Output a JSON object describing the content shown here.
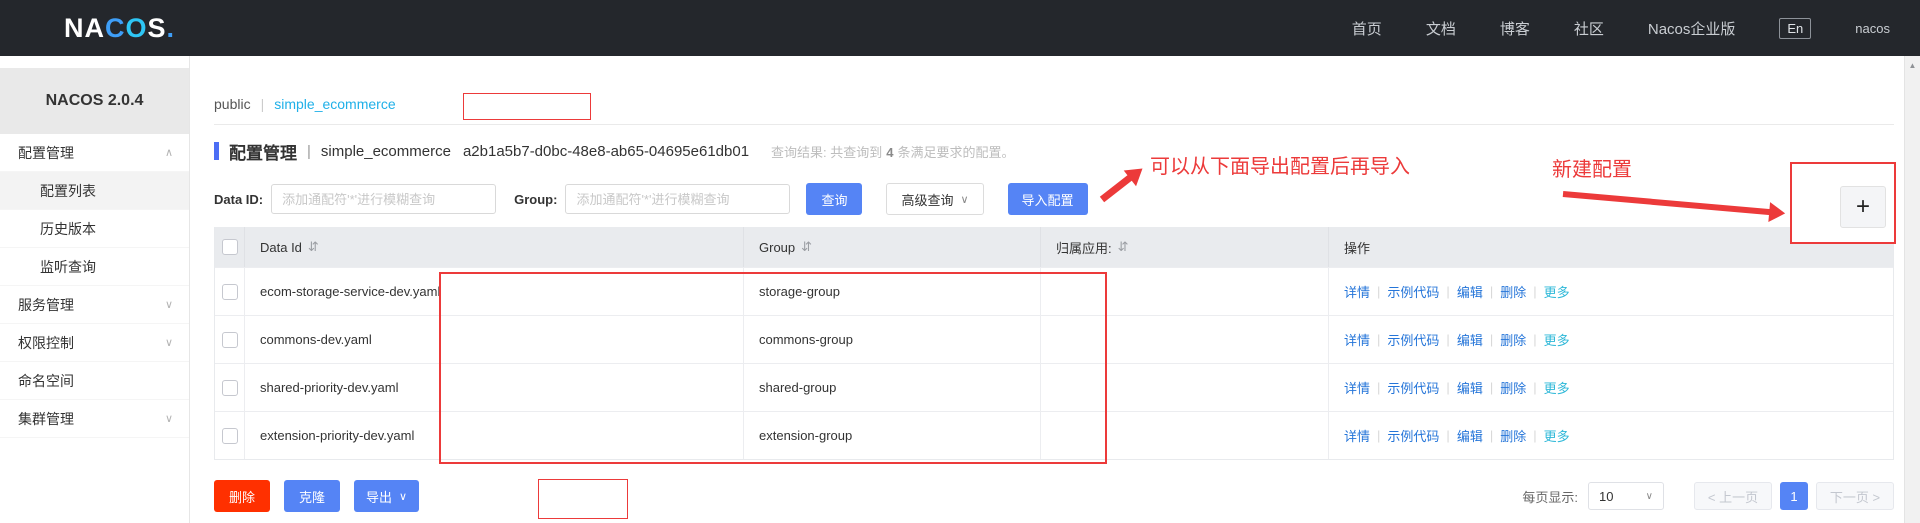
{
  "colors": {
    "primary_blue": "#5584f5",
    "danger_red": "#ff3000",
    "link_blue": "#2575d9",
    "more_cyan": "#2eb8d8",
    "tab_cyan": "#1fb0e8",
    "annotation_red": "#ec3a3a",
    "navbar_dark": "#24272c",
    "table_header_gray": "#e9ebee"
  },
  "navbar": {
    "logo_parts": [
      "NA",
      "C",
      "O",
      "S",
      "."
    ],
    "items": [
      "首页",
      "文档",
      "博客",
      "社区",
      "Nacos企业版"
    ],
    "lang": "En",
    "username": "nacos"
  },
  "sidebar": {
    "version": "NACOS 2.0.4",
    "items": [
      {
        "label": "配置管理"
      },
      {
        "label": "配置列表"
      },
      {
        "label": "历史版本"
      },
      {
        "label": "监听查询"
      },
      {
        "label": "服务管理"
      },
      {
        "label": "权限控制"
      },
      {
        "label": "命名空间"
      },
      {
        "label": "集群管理"
      }
    ]
  },
  "tabs": {
    "namespace": "public",
    "separator": "|",
    "current": "simple_ecommerce"
  },
  "title": {
    "section": "配置管理",
    "separator": "|",
    "namespace": "simple_ecommerce",
    "uuid": "a2b1a5b7-d0bc-48e8-ab65-04695e61db01",
    "result_prefix": "查询结果: 共查询到",
    "result_count": "4",
    "result_suffix": "条满足要求的配置。"
  },
  "toolbar": {
    "data_id_label": "Data ID:",
    "group_label": "Group:",
    "fuzzy_placeholder": "添加通配符'*'进行模糊查询",
    "search": "查询",
    "advanced": "高级查询",
    "import": "导入配置"
  },
  "annotations": {
    "import_tip": "可以从下面导出配置后再导入",
    "new_config_tip": "新建配置"
  },
  "icons": {
    "chevron_up": "∧",
    "chevron_down": "∨",
    "caret_down": "∨",
    "sort": "⇵",
    "plus": "+",
    "scroll_up": "▲"
  },
  "table": {
    "headers": [
      "Data Id",
      "Group",
      "归属应用:",
      "操作"
    ],
    "action_labels": [
      "详情",
      "示例代码",
      "编辑",
      "删除",
      "更多"
    ],
    "action_separator": "|",
    "rows": [
      {
        "data_id": "ecom-storage-service-dev.yaml",
        "group": "storage-group"
      },
      {
        "data_id": "commons-dev.yaml",
        "group": "commons-group"
      },
      {
        "data_id": "shared-priority-dev.yaml",
        "group": "shared-group"
      },
      {
        "data_id": "extension-priority-dev.yaml",
        "group": "extension-group"
      }
    ]
  },
  "footer": {
    "delete": "删除",
    "clone": "克隆",
    "export": "导出",
    "page_size_label": "每页显示:",
    "page_size": "10",
    "prev": "< 上一页",
    "current_page": "1",
    "next": "下一页 >"
  }
}
